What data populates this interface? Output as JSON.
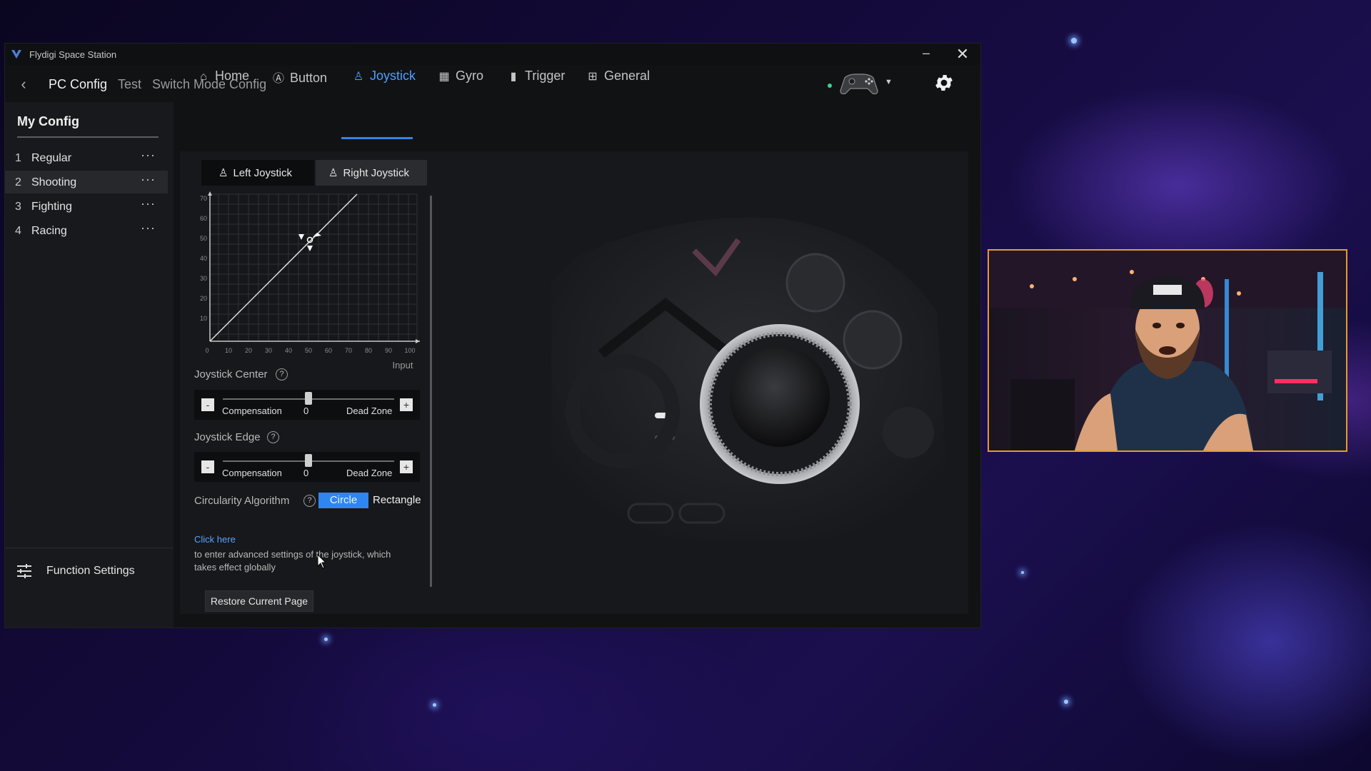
{
  "window": {
    "title": "Flydigi Space Station"
  },
  "topnav": {
    "links": [
      "PC Config",
      "Test",
      "Switch Mode Config"
    ],
    "active": "PC Config"
  },
  "sidebar": {
    "title": "My Config",
    "items": [
      {
        "num": "1",
        "label": "Regular"
      },
      {
        "num": "2",
        "label": "Shooting"
      },
      {
        "num": "3",
        "label": "Fighting"
      },
      {
        "num": "4",
        "label": "Racing"
      }
    ],
    "more_glyph": "···",
    "active_item": "Shooting",
    "function_settings": "Function Settings"
  },
  "tabs": [
    {
      "label": "Home",
      "icon": "home-icon"
    },
    {
      "label": "Button",
      "icon": "button-icon"
    },
    {
      "label": "Joystick",
      "icon": "joystick-icon"
    },
    {
      "label": "Gyro",
      "icon": "gyro-icon"
    },
    {
      "label": "Trigger",
      "icon": "trigger-icon"
    },
    {
      "label": "General",
      "icon": "general-icon"
    }
  ],
  "active_tab": "Joystick",
  "joystick": {
    "subtabs": [
      "Left Joystick",
      "Right Joystick"
    ],
    "active_subtab": "Right Joystick",
    "graph": {
      "y_ticks": [
        "70",
        "60",
        "50",
        "40",
        "30",
        "20",
        "10"
      ],
      "x_ticks": [
        "0",
        "10",
        "20",
        "30",
        "40",
        "50",
        "60",
        "70",
        "80",
        "90",
        "100"
      ],
      "x_label": "Input"
    },
    "center": {
      "label": "Joystick Center",
      "left_label": "Compensation",
      "value": "0",
      "right_label": "Dead Zone",
      "minus": "-",
      "plus": "+",
      "position": 0.5
    },
    "edge": {
      "label": "Joystick Edge",
      "left_label": "Compensation",
      "value": "0",
      "right_label": "Dead Zone",
      "minus": "-",
      "plus": "+",
      "position": 0.5
    },
    "circularity": {
      "label": "Circularity Algorithm",
      "options": [
        "Circle",
        "Rectangle"
      ],
      "selected": "Circle"
    },
    "help_glyph": "?",
    "click_here": "Click here",
    "advanced_text": "to enter advanced settings of the joystick, which takes effect globally",
    "restore": "Restore Current Page"
  },
  "colors": {
    "accent": "#2f86f0",
    "link": "#5aa2ff",
    "webcam_border": "#e89a2c"
  }
}
